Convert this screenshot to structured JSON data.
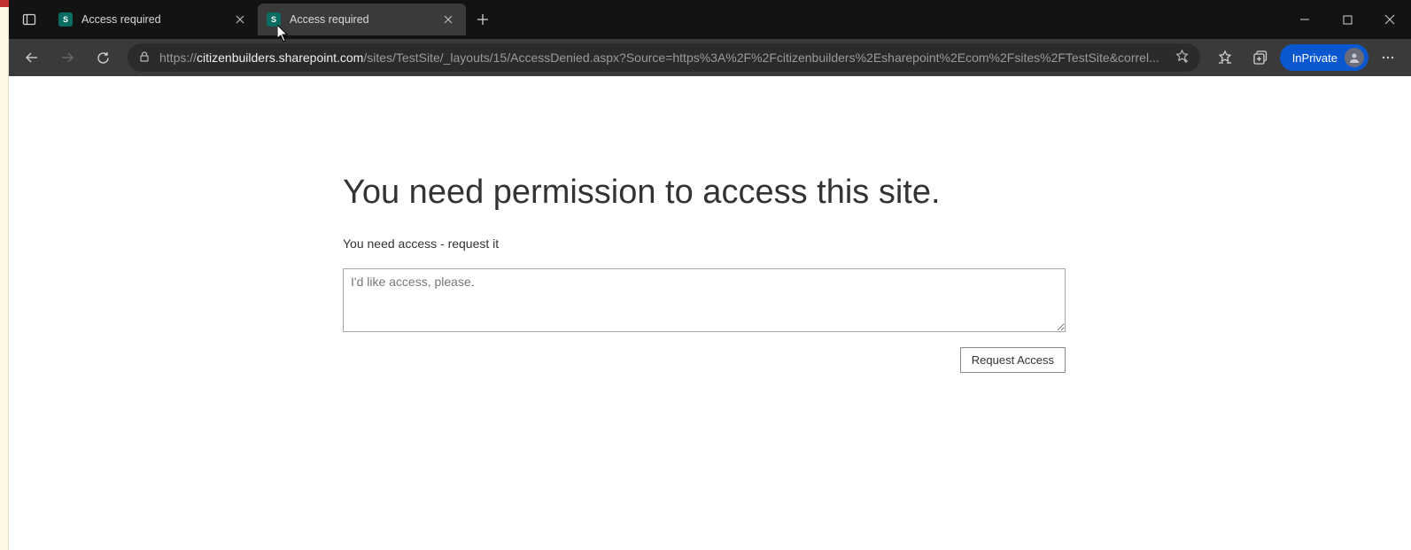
{
  "tabs": [
    {
      "title": "Access required",
      "favicon_letter": "S"
    },
    {
      "title": "Access required",
      "favicon_letter": "S"
    }
  ],
  "url": {
    "scheme": "https://",
    "host": "citizenbuilders.sharepoint.com",
    "path": "/sites/TestSite/_layouts/15/AccessDenied.aspx?Source=https%3A%2F%2Fcitizenbuilders%2Esharepoint%2Ecom%2Fsites%2FTestSite&correl..."
  },
  "inprivate_label": "InPrivate",
  "page": {
    "title": "You need permission to access this site.",
    "subtitle": "You need access - request it",
    "textarea_placeholder": "I'd like access, please.",
    "button_label": "Request Access"
  }
}
